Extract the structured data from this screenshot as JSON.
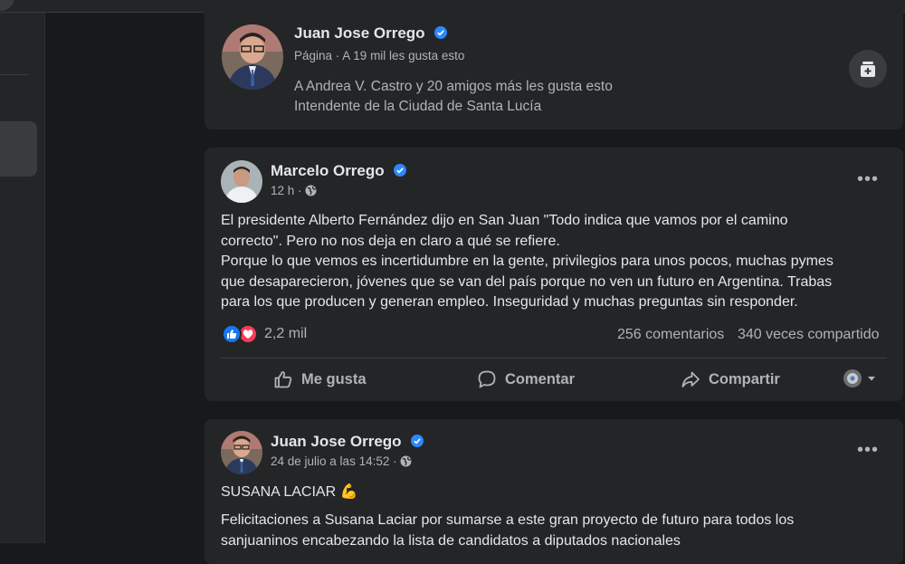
{
  "page_card": {
    "name": "Juan Jose Orrego",
    "subtitle": "Página · A 19 mil les gusta esto",
    "friends_like": "A Andrea V. Castro y 20 amigos más les gusta esto",
    "role": "Intendente de la Ciudad de Santa Lucía",
    "icon": "add-bookmark-icon"
  },
  "post1": {
    "author": "Marcelo Orrego",
    "time": "12 h ·",
    "privacy_icon": "globe-icon",
    "text_lines": [
      "El presidente Alberto Fernández dijo en San Juan \"Todo indica que vamos por el camino",
      "correcto\". Pero no nos deja en claro a qué se refiere.",
      "Porque lo que vemos es incertidumbre en la gente, privilegios para unos pocos, muchas pymes",
      "que desaparecieron, jóvenes que se van del país porque no ven un futuro en Argentina. Trabas",
      "para los que producen y generan empleo. Inseguridad y muchas preguntas sin responder."
    ],
    "reactions_count": "2,2 mil",
    "comments": "256 comentarios",
    "shares": "340 veces compartido",
    "actions": {
      "like": "Me gusta",
      "comment": "Comentar",
      "share": "Compartir"
    }
  },
  "post2": {
    "author": "Juan Jose Orrego",
    "time": "24 de julio a las 14:52 ·",
    "privacy_icon": "globe-icon",
    "text_lines": [
      "SUSANA LACIAR 💪",
      "Felicitaciones a Susana Laciar por sumarse a este gran proyecto de futuro para todos los",
      "sanjuaninos encabezando la lista de candidatos a diputados nacionales"
    ]
  },
  "colors": {
    "background": "#18191a",
    "card": "#242526",
    "text_primary": "#e4e6eb",
    "text_secondary": "#b0b3b8",
    "verified": "#2d88ff",
    "like": "#1877f2",
    "love": "#f33e58"
  }
}
